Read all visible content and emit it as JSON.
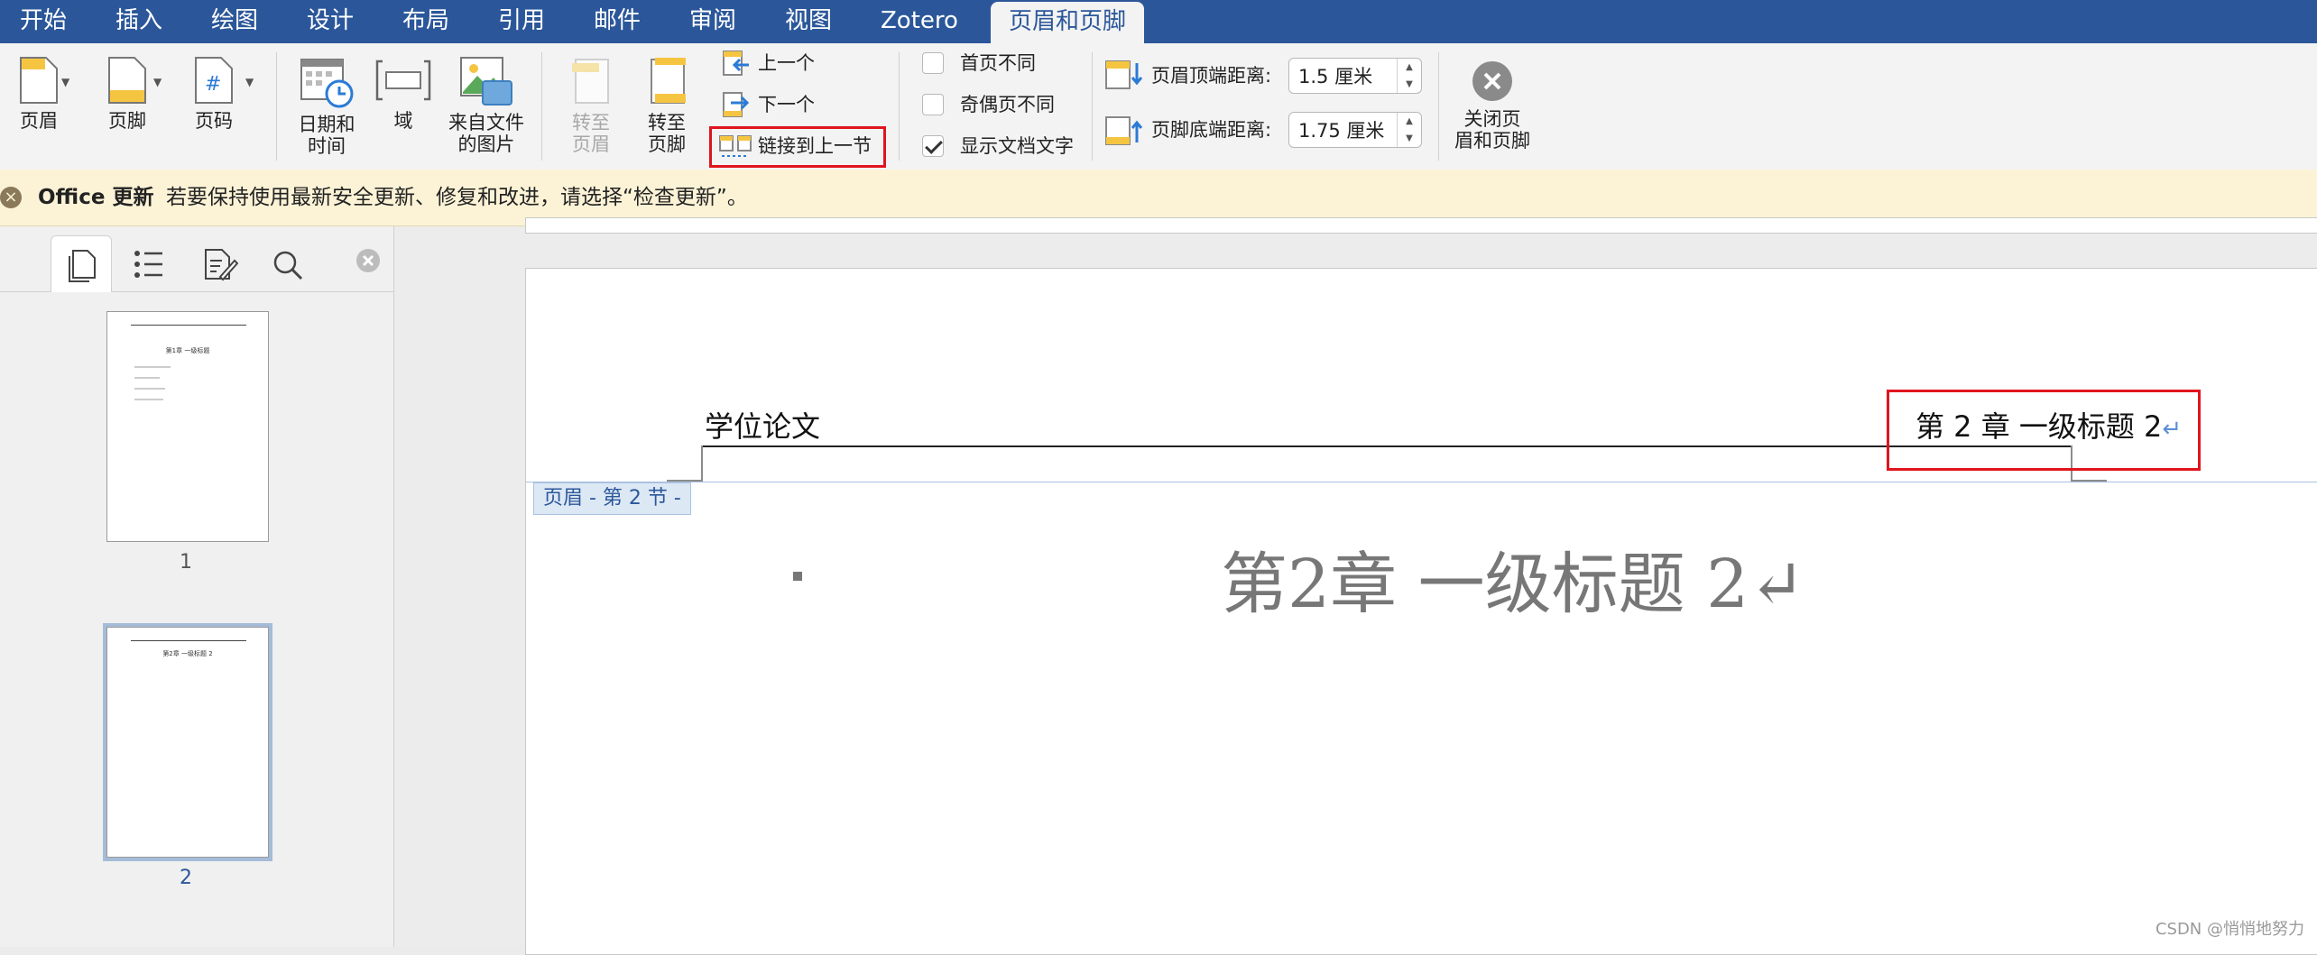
{
  "tabs": [
    {
      "label": "开始",
      "active": false
    },
    {
      "label": "插入",
      "active": false
    },
    {
      "label": "绘图",
      "active": false
    },
    {
      "label": "设计",
      "active": false
    },
    {
      "label": "布局",
      "active": false
    },
    {
      "label": "引用",
      "active": false
    },
    {
      "label": "邮件",
      "active": false
    },
    {
      "label": "审阅",
      "active": false
    },
    {
      "label": "视图",
      "active": false
    },
    {
      "label": "Zotero",
      "active": false
    },
    {
      "label": "页眉和页脚",
      "active": true
    }
  ],
  "ribbon": {
    "header_btn": "页眉",
    "footer_btn": "页脚",
    "pagenum_btn": "页码",
    "datetime_btn_l1": "日期和",
    "datetime_btn_l2": "时间",
    "field_btn": "域",
    "picture_btn_l1": "来自文件",
    "picture_btn_l2": "的图片",
    "goto_header_l1": "转至",
    "goto_header_l2": "页眉",
    "goto_footer_l1": "转至",
    "goto_footer_l2": "页脚",
    "previous": "上一个",
    "next": "下一个",
    "link_to_previous": "链接到上一节",
    "different_first_page": "首页不同",
    "different_odd_even": "奇偶页不同",
    "show_document_text": "显示文档文字",
    "header_from_top_label": "页眉顶端距离:",
    "header_from_top_value": "1.5 厘米",
    "footer_from_bottom_label": "页脚底端距离:",
    "footer_from_bottom_value": "1.75 厘米",
    "close_l1": "关闭页",
    "close_l2": "眉和页脚",
    "checkbox_states": {
      "different_first_page": false,
      "different_odd_even": false,
      "show_document_text": true
    }
  },
  "banner": {
    "title": "Office 更新",
    "message": "若要保持使用最新安全更新、修复和改进，请选择“检查更新”。"
  },
  "sidebar": {
    "thumb1_heading": "第1章 一级标题",
    "thumb2_heading": "第2章 一级标题 2",
    "pages": [
      "1",
      "2"
    ]
  },
  "document": {
    "header_left": "学位论文",
    "header_right": "第 2 章  一级标题 2",
    "return_mark": "↵",
    "section_label": "页眉 - 第 2 节 -",
    "heading": "第2章 一级标题 2↵"
  },
  "watermark": "CSDN @悄悄地努力",
  "colors": {
    "ribbon_accent": "#2b579a",
    "highlight": "#e0141e"
  }
}
